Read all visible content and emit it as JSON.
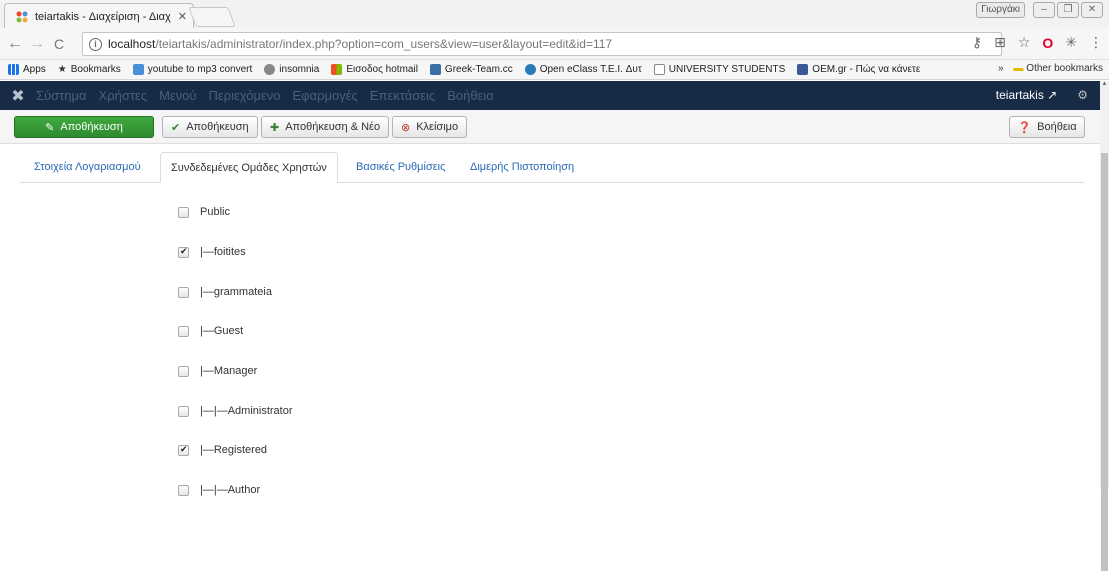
{
  "browser": {
    "tab_title": "teiartakis - Διαχείριση - Διαχ",
    "profile_name": "Γιωργάκι",
    "url_host": "localhost",
    "url_path": "/teiartakis/administrator/index.php?option=com_users&view=user&layout=edit&id=117"
  },
  "bookmarks": {
    "items": [
      {
        "label": "Apps",
        "icon": "apps-icon",
        "color": "#1a73e8"
      },
      {
        "label": "Bookmarks",
        "icon": "star-icon",
        "color": "#333333"
      },
      {
        "label": "youtube to mp3 convert",
        "icon": "mp3-icon",
        "color": "#4a90d9"
      },
      {
        "label": "insomnia",
        "icon": "insomnia-icon",
        "color": "#888888"
      },
      {
        "label": "Εισοδος hotmail",
        "icon": "windows-icon",
        "color": "#f25022"
      },
      {
        "label": "Greek-Team.cc",
        "icon": "greekteam-icon",
        "color": "#3a6ea5"
      },
      {
        "label": "Open eClass T.E.I. Δυτ",
        "icon": "eclass-icon",
        "color": "#2b7bb9"
      },
      {
        "label": "UNIVERSITY STUDENTS",
        "icon": "page-icon",
        "color": "#ffffff"
      },
      {
        "label": "OEM.gr - Πώς να κάνετε",
        "icon": "oem-icon",
        "color": "#3b5998"
      }
    ],
    "overflow_label": "»",
    "other_label": "Other bookmarks"
  },
  "joomla_nav": {
    "menus": [
      "Σύστημα",
      "Χρήστες",
      "Μενού",
      "Περιεχόμενο",
      "Εφαρμογές",
      "Επεκτάσεις",
      "Βοήθεια"
    ],
    "site_name": "teiartakis"
  },
  "toolbar": {
    "save_label": "Αποθήκευση",
    "save_close_label": "Αποθήκευση",
    "save_new_label": "Αποθήκευση & Νέο",
    "close_label": "Κλείσιμο",
    "help_label": "Βοήθεια"
  },
  "tabs": [
    {
      "label": "Στοιχεία Λογαριασμού"
    },
    {
      "label": "Συνδεδεμένες Ομάδες Χρηστών"
    },
    {
      "label": "Βασικές Ρυθμίσεις"
    },
    {
      "label": "Διμερής Πιστοποίηση"
    }
  ],
  "active_tab": "Συνδεδεμένες Ομάδες Χρηστών",
  "groups": [
    {
      "label": "Public",
      "checked": false
    },
    {
      "label": "|—foitites",
      "checked": true
    },
    {
      "label": "|—grammateia",
      "checked": false
    },
    {
      "label": "|—Guest",
      "checked": false
    },
    {
      "label": "|—Manager",
      "checked": false
    },
    {
      "label": "|—|—Administrator",
      "checked": false
    },
    {
      "label": "|—Registered",
      "checked": true
    },
    {
      "label": "|—|—Author",
      "checked": false
    }
  ]
}
